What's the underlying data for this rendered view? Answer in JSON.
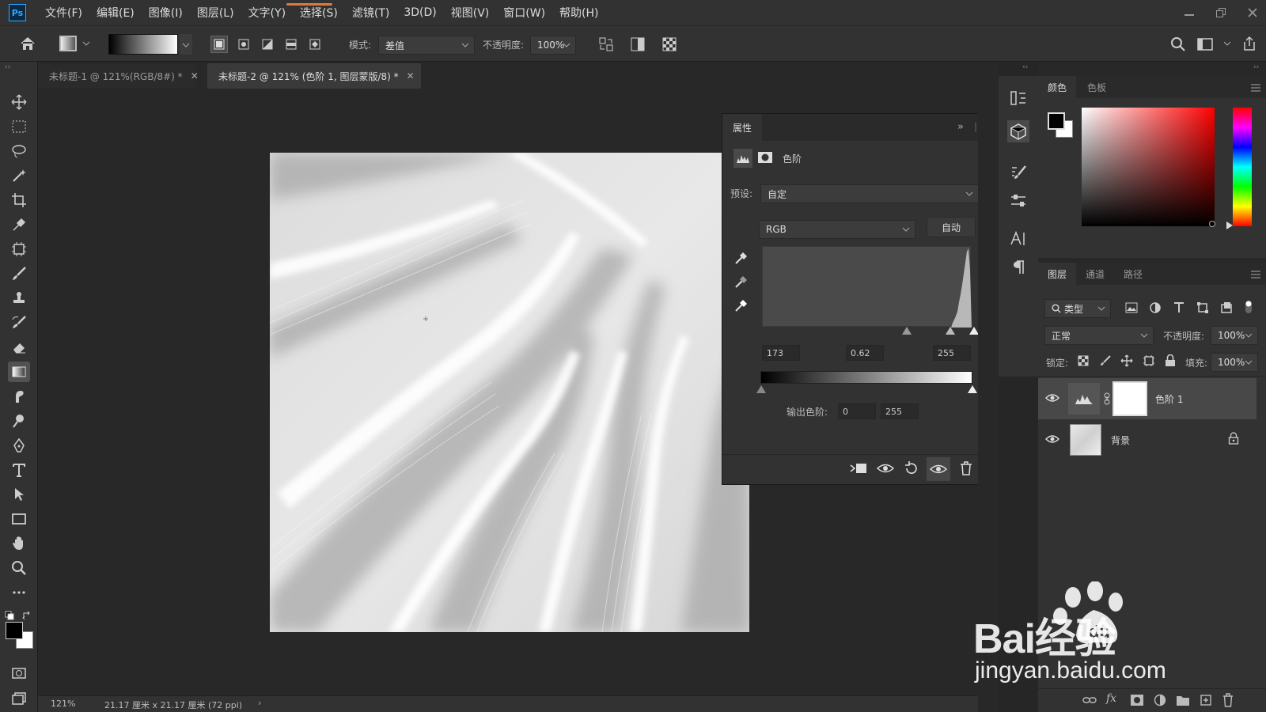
{
  "app": {
    "logo_text": "Ps",
    "menu": [
      "文件(F)",
      "编辑(E)",
      "图像(I)",
      "图层(L)",
      "文字(Y)",
      "选择(S)",
      "滤镜(T)",
      "3D(D)",
      "视图(V)",
      "窗口(W)",
      "帮助(H)"
    ]
  },
  "options": {
    "mode_label": "模式:",
    "mode_value": "差值",
    "opacity_label": "不透明度:",
    "opacity_value": "100%"
  },
  "tabs": [
    {
      "label": "未标题-1 @ 121%(RGB/8#) *",
      "active": false
    },
    {
      "label": "未标题-2 @ 121% (色阶 1, 图层蒙版/8) *",
      "active": true
    }
  ],
  "status": {
    "zoom": "121%",
    "doc_info": "21.17 厘米 x 21.17 厘米 (72 ppi)"
  },
  "properties": {
    "tab_label": "属性",
    "adjustment_name": "色阶",
    "preset_label": "预设:",
    "preset_value": "自定",
    "channel_value": "RGB",
    "auto_label": "自动",
    "input_black": "173",
    "input_gamma": "0.62",
    "input_white": "255",
    "output_label": "输出色阶:",
    "output_black": "0",
    "output_white": "255"
  },
  "color_panel": {
    "tabs": [
      "颜色",
      "色板"
    ],
    "foreground": "#000000",
    "background": "#ffffff"
  },
  "layers_panel": {
    "tabs": [
      "图层",
      "通道",
      "路径"
    ],
    "filter_label": "类型",
    "blend_mode": "正常",
    "opacity_label": "不透明度:",
    "opacity_value": "100%",
    "lock_label": "锁定:",
    "fill_label": "填充:",
    "fill_value": "100%",
    "layers": [
      {
        "name": "色阶 1",
        "selected": true,
        "locked": false
      },
      {
        "name": "背景",
        "selected": false,
        "locked": true
      }
    ]
  },
  "watermark": {
    "brand": "Bai经验",
    "url": "jingyan.baidu.com"
  }
}
